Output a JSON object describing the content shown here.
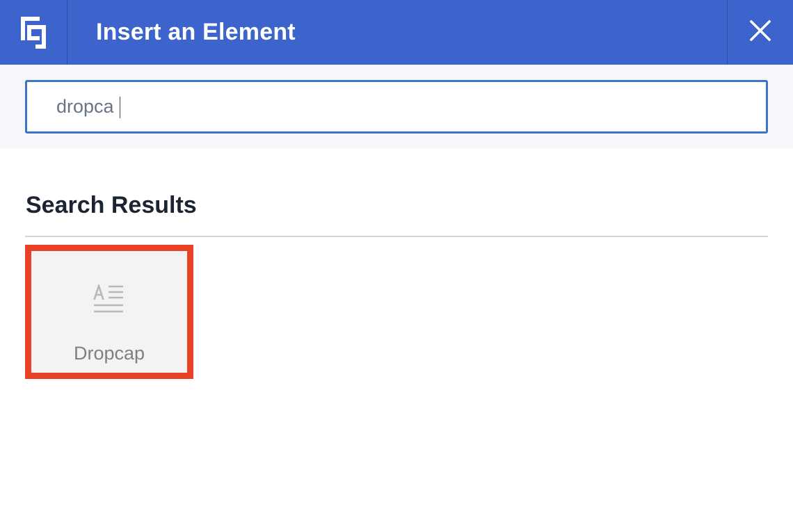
{
  "header": {
    "logo_icon": "builder-logo-icon",
    "title": "Insert an Element",
    "close_icon": "close-icon",
    "background": "#3d63cc"
  },
  "search": {
    "value": "dropca",
    "border_color": "#3d74c9"
  },
  "results": {
    "title": "Search Results",
    "items": [
      {
        "label": "Dropcap",
        "icon": "dropcap-icon",
        "highlight_color": "#e94126"
      }
    ]
  }
}
